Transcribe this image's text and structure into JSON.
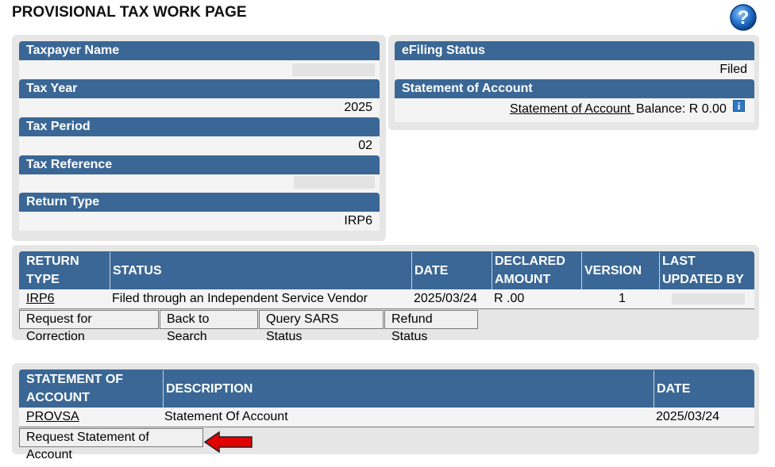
{
  "page": {
    "title": "PROVISIONAL TAX WORK PAGE",
    "icons": {
      "help": "help-question-icon",
      "info": "info-icon",
      "arrow": "red-left-arrow-icon"
    }
  },
  "details": {
    "taxpayer_name_label": "Taxpayer Name",
    "taxpayer_name_value": "",
    "tax_year_label": "Tax Year",
    "tax_year_value": "2025",
    "tax_period_label": "Tax Period",
    "tax_period_value": "02",
    "tax_reference_label": "Tax Reference",
    "tax_reference_value": "",
    "return_type_label": "Return Type",
    "return_type_value": "IRP6"
  },
  "status": {
    "efiling_status_label": "eFiling Status",
    "efiling_status_value": "Filed",
    "statement_label": "Statement of Account",
    "statement_link": "Statement of Account ",
    "balance_text": "Balance: R 0.00"
  },
  "returns": {
    "headers": {
      "return_type_1": "RETURN",
      "return_type_2": "TYPE",
      "status": "STATUS",
      "date": "DATE",
      "declared_1": "DECLARED",
      "declared_2": "AMOUNT",
      "version": "VERSION",
      "last_updated_1": "LAST",
      "last_updated_2": "UPDATED BY"
    },
    "row": {
      "return_type": "IRP6",
      "status": "Filed through an Independent Service Vendor",
      "date": "2025/03/24",
      "declared_amount": "R .00",
      "version": "1",
      "last_updated_by": ""
    },
    "buttons": {
      "request_correction": "Request for Correction",
      "back_to_search": "Back to Search",
      "query_sars_status": "Query SARS Status",
      "refund_status": "Refund Status"
    }
  },
  "statement": {
    "headers": {
      "soa_1": "STATEMENT OF",
      "soa_2": "ACCOUNT",
      "description": "DESCRIPTION",
      "date": "DATE"
    },
    "row": {
      "soa": "PROVSA",
      "description": "Statement Of Account",
      "date": "2025/03/24"
    },
    "buttons": {
      "request_statement": "Request Statement of Account"
    }
  },
  "colors": {
    "header_blue": "#3a6795",
    "panel_gray": "#e6e6e6",
    "arrow_red": "#e00000"
  }
}
